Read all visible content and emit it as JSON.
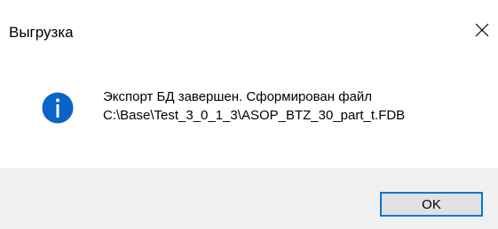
{
  "window": {
    "title": "Выгрузка",
    "close_icon": "close-icon"
  },
  "message": {
    "icon": "info-icon",
    "line1": "Экспорт БД завершен. Сформирован файл",
    "line2": "C:\\Base\\Test_3_0_1_3\\ASOP_BTZ_30_part_t.FDB"
  },
  "footer": {
    "ok_label": "OK"
  },
  "colors": {
    "accent": "#0078d7",
    "footer_bg": "#f0f0f0",
    "button_bg": "#e1e1e1"
  }
}
